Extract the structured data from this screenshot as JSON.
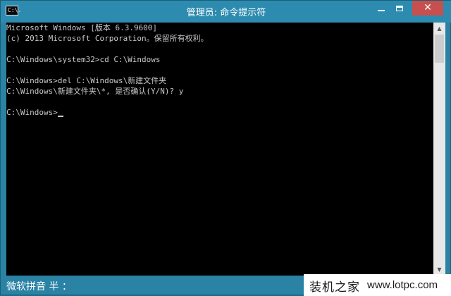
{
  "window": {
    "title": "管理员: 命令提示符",
    "icon_text": "C:\\."
  },
  "console": {
    "lines": [
      "Microsoft Windows [版本 6.3.9600]",
      "(c) 2013 Microsoft Corporation。保留所有权利。",
      "",
      "C:\\Windows\\system32>cd C:\\Windows",
      "",
      "C:\\Windows>del C:\\Windows\\新建文件夹",
      "C:\\Windows\\新建文件夹\\*, 是否确认(Y/N)? y",
      "",
      "C:\\Windows>"
    ]
  },
  "ime": {
    "status": "微软拼音 半 ："
  },
  "watermark": {
    "brand": "装机之家",
    "url": "www.lotpc.com"
  },
  "icons": {
    "minimize": "minimize-icon",
    "maximize": "maximize-icon",
    "close": "close-icon",
    "scroll_up": "scroll-up-arrow-icon",
    "scroll_down": "scroll-down-arrow-icon"
  },
  "colors": {
    "title_bar": "#2d8bb0",
    "close_button": "#c7504f",
    "console_background": "#000000",
    "console_text": "#c8c8c8"
  }
}
